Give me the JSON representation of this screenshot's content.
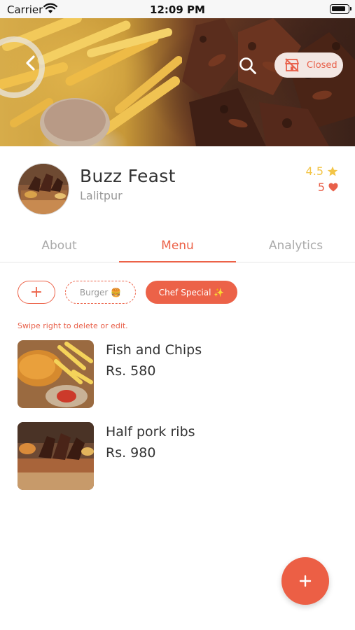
{
  "status_bar": {
    "carrier": "Carrier",
    "time": "12:09 PM"
  },
  "header": {
    "closed_label": "Closed"
  },
  "restaurant": {
    "name": "Buzz Feast",
    "location": "Lalitpur",
    "rating": "4.5",
    "likes": "5"
  },
  "tabs": [
    {
      "label": "About",
      "active": false
    },
    {
      "label": "Menu",
      "active": true
    },
    {
      "label": "Analytics",
      "active": false
    }
  ],
  "categories": {
    "add_label": "+",
    "items": [
      {
        "label": "Burger 🍔",
        "selected": false
      },
      {
        "label": "Chef Special ✨",
        "selected": true
      }
    ]
  },
  "hint": "Swipe right to delete or edit.",
  "menu_items": [
    {
      "name": "Fish and Chips",
      "price": "Rs. 580"
    },
    {
      "name": "Half pork ribs",
      "price": "Rs. 980"
    }
  ],
  "colors": {
    "accent": "#ec6248",
    "star": "#f3c547",
    "heart": "#e8604a"
  },
  "icons": {
    "back": "chevron-left-icon",
    "search": "search-icon",
    "closed_store": "store-closed-icon",
    "star": "star-icon",
    "heart": "heart-icon",
    "fab": "plus-icon"
  }
}
